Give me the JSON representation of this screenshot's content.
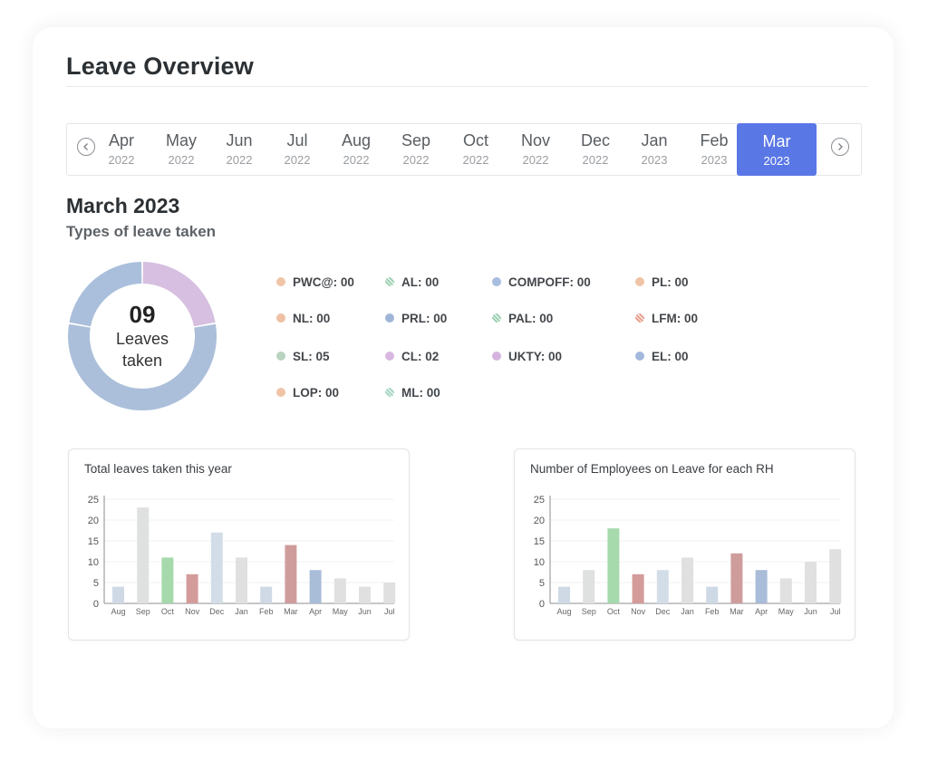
{
  "page": {
    "title": "Leave Overview"
  },
  "month_bar": {
    "months": [
      {
        "month": "Apr",
        "year": "2022",
        "active": false
      },
      {
        "month": "May",
        "year": "2022",
        "active": false
      },
      {
        "month": "Jun",
        "year": "2022",
        "active": false
      },
      {
        "month": "Jul",
        "year": "2022",
        "active": false
      },
      {
        "month": "Aug",
        "year": "2022",
        "active": false
      },
      {
        "month": "Sep",
        "year": "2022",
        "active": false
      },
      {
        "month": "Oct",
        "year": "2022",
        "active": false
      },
      {
        "month": "Nov",
        "year": "2022",
        "active": false
      },
      {
        "month": "Dec",
        "year": "2022",
        "active": false
      },
      {
        "month": "Jan",
        "year": "2023",
        "active": false
      },
      {
        "month": "Feb",
        "year": "2023",
        "active": false
      },
      {
        "month": "Mar",
        "year": "2023",
        "active": true
      }
    ],
    "prev_icon": "chevron-left-icon",
    "next_icon": "chevron-right-icon",
    "active_color": "#5a77e6"
  },
  "summary": {
    "title": "March 2023",
    "subtitle": "Types of leave taken",
    "count": "09",
    "count_label_line1": "Leaves",
    "count_label_line2": "taken",
    "donut_segments": [
      {
        "label": "CL",
        "value": 2,
        "color": "#d6bfe0"
      },
      {
        "label": "SL",
        "value": 5,
        "color": "#acbfda"
      },
      {
        "label": "other",
        "value": 2,
        "color": "#aabfdb"
      }
    ]
  },
  "legend": [
    {
      "label": "PWC@: 00",
      "color": "#f0c4a6",
      "pattern": false
    },
    {
      "label": "AL: 00",
      "color": "#9fd1b4",
      "pattern": true
    },
    {
      "label": "COMPOFF: 00",
      "color": "#a8bde0",
      "pattern": false
    },
    {
      "label": "PL: 00",
      "color": "#f0c4a6",
      "pattern": false
    },
    {
      "label": "NL: 00",
      "color": "#efc0a4",
      "pattern": false
    },
    {
      "label": "PRL: 00",
      "color": "#9fb6d8",
      "pattern": false
    },
    {
      "label": "PAL: 00",
      "color": "#9fd1b4",
      "pattern": true
    },
    {
      "label": "LFM: 00",
      "color": "#e7a28f",
      "pattern": true
    },
    {
      "label": "SL: 05",
      "color": "#b8d4c0",
      "pattern": false
    },
    {
      "label": "CL: 02",
      "color": "#d9b8e0",
      "pattern": false
    },
    {
      "label": "UKTY: 00",
      "color": "#d4b4df",
      "pattern": false
    },
    {
      "label": "EL: 00",
      "color": "#a3b8dc",
      "pattern": false
    },
    {
      "label": "LOP: 00",
      "color": "#f0c4a6",
      "pattern": false
    },
    {
      "label": "ML: 00",
      "color": "#a6d6c2",
      "pattern": true
    }
  ],
  "chart_data": [
    {
      "type": "bar",
      "title": "Total leaves taken this year",
      "categories": [
        "Aug",
        "Sep",
        "Oct",
        "Nov",
        "Dec",
        "Jan",
        "Feb",
        "Mar",
        "Apr",
        "May",
        "Jun",
        "Jul"
      ],
      "values": [
        4,
        23,
        11,
        7,
        17,
        11,
        4,
        14,
        8,
        6,
        4,
        5
      ],
      "colors": [
        "#cfd9e6",
        "#dfe0e0",
        "#a6d9ac",
        "#d49b9b",
        "#d3dde8",
        "#e0e0e0",
        "#cfd9e6",
        "#cf9c9c",
        "#a9bcd8",
        "#e0e0e0",
        "#e0e0e0",
        "#e0e0e0"
      ],
      "yticks": [
        0,
        5,
        10,
        15,
        20,
        25
      ],
      "ylim": [
        0,
        25
      ],
      "xlabel": "",
      "ylabel": "",
      "grid": true
    },
    {
      "type": "bar",
      "title": "Number of Employees on Leave for each RH",
      "categories": [
        "Aug",
        "Sep",
        "Oct",
        "Nov",
        "Dec",
        "Jan",
        "Feb",
        "Mar",
        "Apr",
        "May",
        "Jun",
        "Jul"
      ],
      "values": [
        4,
        8,
        18,
        7,
        8,
        11,
        4,
        12,
        8,
        6,
        10,
        13
      ],
      "colors": [
        "#cfd9e6",
        "#dfe0e0",
        "#a6d9ac",
        "#d49b9b",
        "#d3dde8",
        "#e0e0e0",
        "#cfd9e6",
        "#cf9c9c",
        "#a9bcd8",
        "#e0e0e0",
        "#e0e0e0",
        "#e0e0e0"
      ],
      "yticks": [
        0,
        5,
        10,
        15,
        20,
        25
      ],
      "ylim": [
        0,
        25
      ],
      "xlabel": "",
      "ylabel": "",
      "grid": true
    }
  ]
}
